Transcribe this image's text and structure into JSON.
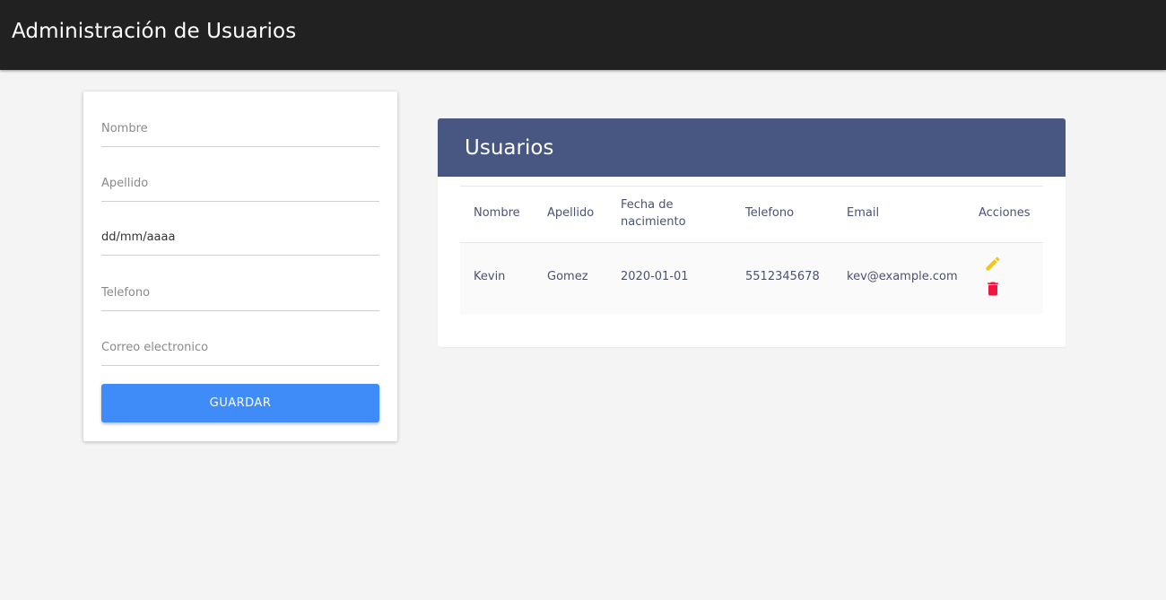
{
  "app": {
    "title": "Administración de Usuarios"
  },
  "form": {
    "fields": [
      {
        "name": "nombre",
        "placeholder": "Nombre",
        "value": ""
      },
      {
        "name": "apellido",
        "placeholder": "Apellido",
        "value": ""
      },
      {
        "name": "fecha",
        "placeholder": "dd/mm/aaaa",
        "value": ""
      },
      {
        "name": "telefono",
        "placeholder": "Telefono",
        "value": ""
      },
      {
        "name": "correo",
        "placeholder": "Correo electronico",
        "value": ""
      }
    ],
    "save_label": "GUARDAR"
  },
  "users": {
    "title": "Usuarios",
    "columns": [
      "Nombre",
      "Apellido",
      "Fecha de nacimiento",
      "Telefono",
      "Email",
      "Acciones"
    ],
    "rows": [
      {
        "nombre": "Kevin",
        "apellido": "Gomez",
        "fecha": "2020-01-01",
        "telefono": "5512345678",
        "email": "kev@example.com",
        "actions": {
          "edit_icon": "pencil-icon",
          "delete_icon": "trash-icon"
        }
      }
    ]
  },
  "colors": {
    "topbar": "#212121",
    "header": "#475782",
    "button": "#3f8cf8",
    "edit": "#f5c518",
    "delete": "#f0163f"
  }
}
